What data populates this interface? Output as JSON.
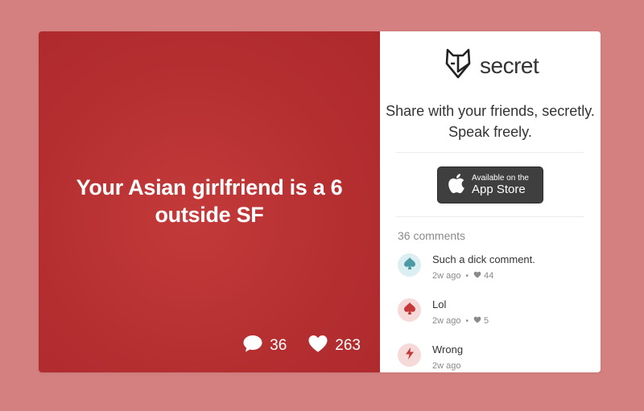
{
  "post": {
    "text": "Your Asian girlfriend is a 6 outside SF",
    "comment_count": "36",
    "like_count": "263"
  },
  "brand": {
    "name": "secret",
    "tagline_line1": "Share with your friends, secretly.",
    "tagline_line2": "Speak freely."
  },
  "appstore": {
    "small_text": "Available on the",
    "big_text": "App Store"
  },
  "comments": {
    "count_label": "36 comments",
    "items": [
      {
        "text": "Such a dick comment.",
        "time": "2w ago",
        "likes": "44",
        "icon": "spade-icon",
        "avatar_bg": "#dbeef1",
        "icon_color": "#4d9aa6"
      },
      {
        "text": "Lol",
        "time": "2w ago",
        "likes": "5",
        "icon": "spade-icon",
        "avatar_bg": "#f6dada",
        "icon_color": "#c43a3a"
      },
      {
        "text": "Wrong",
        "time": "2w ago",
        "likes": "",
        "icon": "lightning-icon",
        "avatar_bg": "#f6dada",
        "icon_color": "#c43a3a"
      }
    ]
  },
  "colors": {
    "page_bg": "#d47f80",
    "post_bg": "#b52f31",
    "accent": "#c43a3a"
  }
}
